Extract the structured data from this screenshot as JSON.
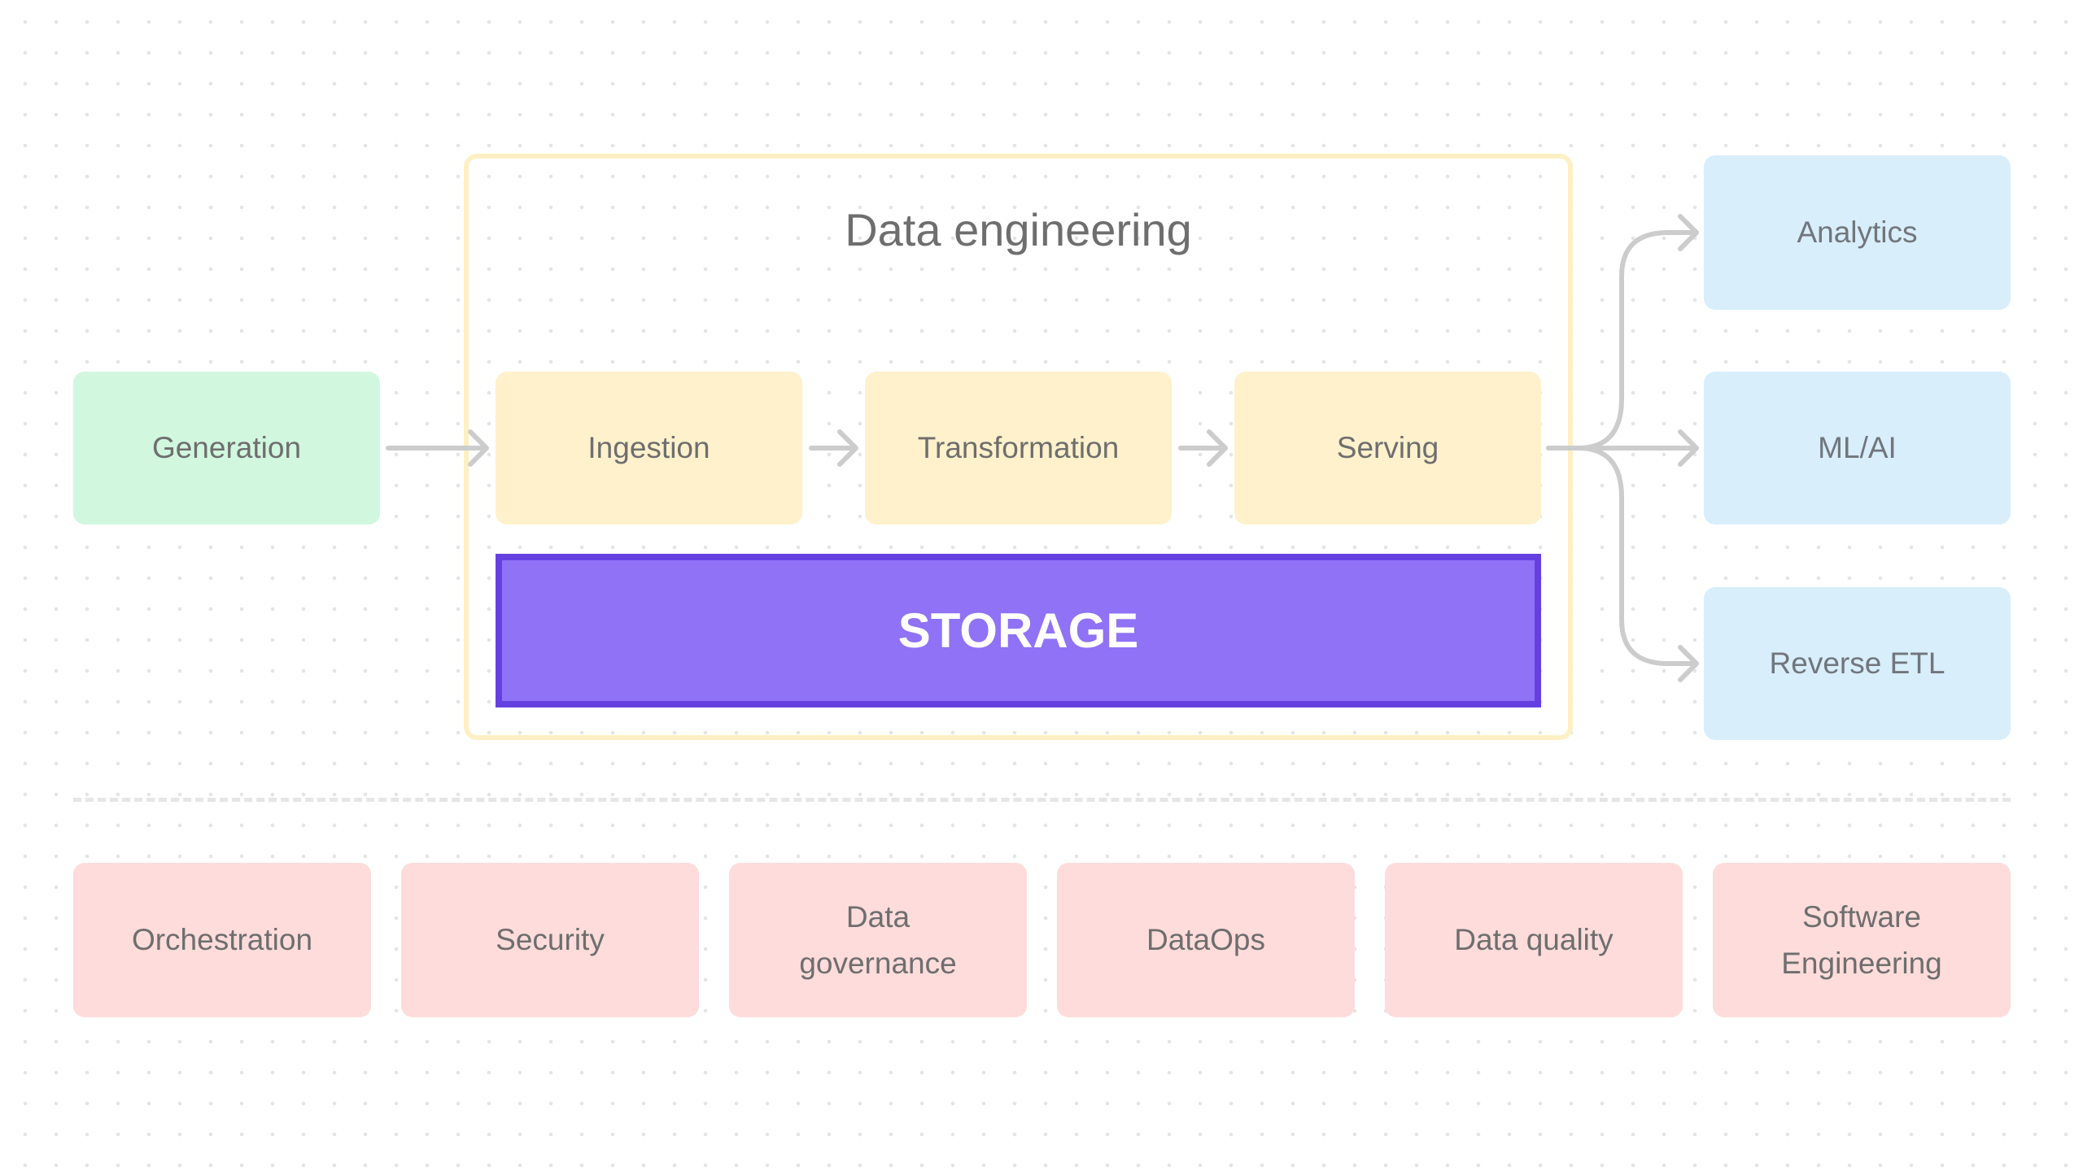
{
  "colors": {
    "source": "#d1f7df",
    "stage": "#fff1cb",
    "consumer": "#d9eefb",
    "undercurrent": "#fedcdb",
    "storage_fill": "#8f72f5",
    "storage_border": "#6540e0",
    "frame": "#fdf0c4",
    "arrow": "#cccccc"
  },
  "title": "Data engineering",
  "source": "Generation",
  "stages": [
    "Ingestion",
    "Transformation",
    "Serving"
  ],
  "storage": "STORAGE",
  "consumers": [
    "Analytics",
    "ML/AI",
    "Reverse ETL"
  ],
  "undercurrents": [
    "Orchestration",
    "Security",
    "Data governance",
    "DataOps",
    "Data quality",
    "Software Engineering"
  ]
}
